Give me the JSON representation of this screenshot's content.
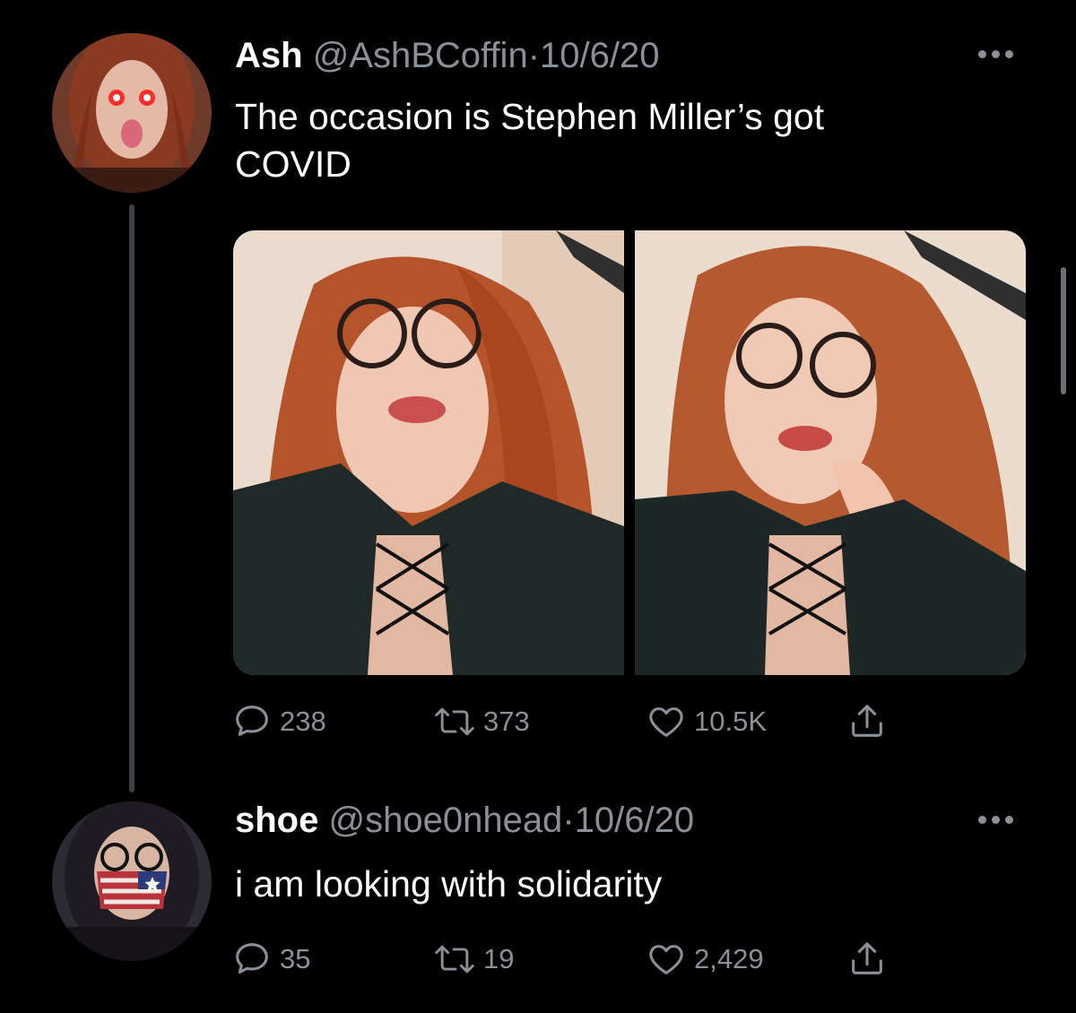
{
  "tweets": [
    {
      "display_name": "Ash",
      "handle": "@AshBCoffin",
      "separator": "·",
      "date": "10/6/20",
      "text_lines": [
        "The occasion is Stephen Miller’s got",
        "COVID"
      ],
      "replies": "238",
      "retweets": "373",
      "likes": "10.5K",
      "media": [
        "selfie-photo-left",
        "selfie-photo-right"
      ]
    },
    {
      "display_name": "shoe",
      "handle": "@shoe0nhead",
      "separator": "·",
      "date": "10/6/20",
      "text_lines": [
        "i am looking with solidarity"
      ],
      "replies": "35",
      "retweets": "19",
      "likes": "2,429"
    }
  ],
  "icons": {
    "reply": "speech-bubble-icon",
    "retweet": "retweet-arrows-icon",
    "like": "heart-icon",
    "share": "share-upload-icon",
    "more": "more-dots-icon"
  },
  "colors": {
    "background": "#000000",
    "primary_text": "#ffffff",
    "secondary_text": "#8b9096",
    "thread_line": "#3d4147"
  }
}
